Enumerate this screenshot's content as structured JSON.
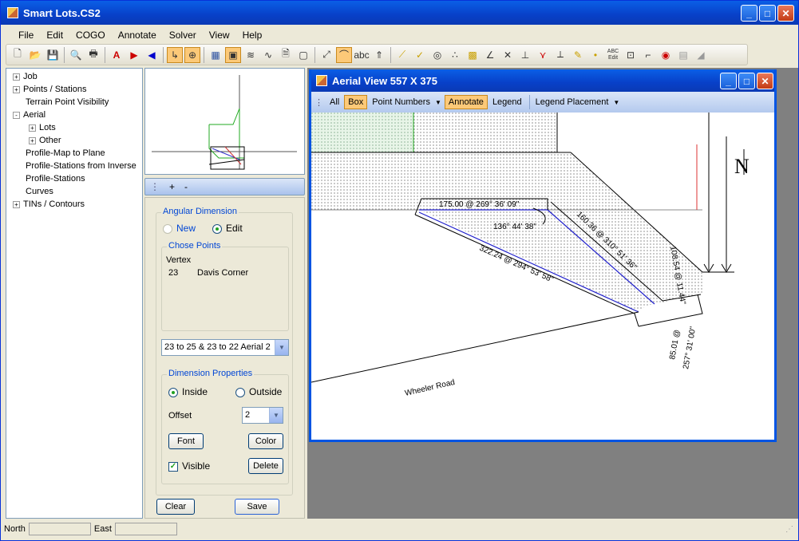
{
  "app": {
    "title": "Smart Lots.CS2"
  },
  "menu": [
    "File",
    "Edit",
    "COGO",
    "Annotate",
    "Solver",
    "View",
    "Help"
  ],
  "toolbar": {
    "abc_label": "abc",
    "abc_edit_label": "ABC Edit"
  },
  "tree": {
    "items": [
      {
        "label": "Job",
        "expander": "+"
      },
      {
        "label": "Points / Stations",
        "expander": "+"
      },
      {
        "label": "Terrain Point Visibility",
        "expander": ""
      },
      {
        "label": "Aerial",
        "expander": "-"
      },
      {
        "label": "Lots",
        "expander": "+"
      },
      {
        "label": "Other",
        "expander": "+"
      },
      {
        "label": "Profile-Map to Plane",
        "expander": ""
      },
      {
        "label": "Profile-Stations from Inverse",
        "expander": ""
      },
      {
        "label": "Profile-Stations",
        "expander": ""
      },
      {
        "label": "Curves",
        "expander": ""
      },
      {
        "label": "TINs / Contours",
        "expander": "+"
      }
    ]
  },
  "panel": {
    "plus": "+",
    "minus": "-",
    "angular": {
      "title": "Angular Dimension",
      "new_label": "New",
      "edit_label": "Edit",
      "selected": "Edit"
    },
    "chose": {
      "title": "Chose Points",
      "header": "Vertex",
      "point_number": "23",
      "point_name": "Davis Corner"
    },
    "dimension_select": "23 to 25  & 23 to 22  Aerial 2",
    "props": {
      "title": "Dimension Properties",
      "inside_label": "Inside",
      "outside_label": "Outside",
      "selected": "Inside",
      "offset_label": "Offset",
      "offset_value": "2",
      "font_button": "Font",
      "color_button": "Color",
      "visible_label": "Visible",
      "visible_checked": true,
      "delete_button": "Delete"
    },
    "clear_button": "Clear",
    "save_button": "Save"
  },
  "aerial": {
    "title": "Aerial View   557  X  375",
    "toolbar": [
      "All",
      "Box",
      "Point Numbers",
      "Annotate",
      "Legend",
      "Legend Placement"
    ],
    "active": [
      "Box",
      "Annotate"
    ],
    "labels": {
      "top": "175.00 @  269° 36' 09\"",
      "angle": "136° 44' 38\"",
      "diag": "322.24 @  294° 53' 58\"",
      "right1": "160.36 @  310° 51' 36\"",
      "right2": "108.54 @  11.44\"",
      "bottom1": "85.01 @",
      "bottom2": "257° 31' 00\"",
      "road": "Wheeler Road",
      "north": "N"
    }
  },
  "status": {
    "north_label": "North",
    "east_label": "East",
    "north_value": "",
    "east_value": ""
  }
}
